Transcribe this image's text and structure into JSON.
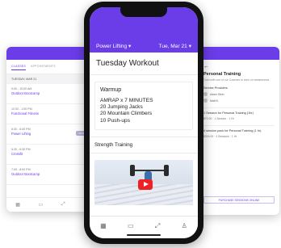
{
  "colors": {
    "accent": "#6a3de8"
  },
  "left_panel": {
    "tabs": [
      "CLASSES",
      "APPOINTMENTS"
    ],
    "day": "TUESDAY, MAR 21",
    "classes": [
      {
        "time": "5:00 - 10:00 AM",
        "name": "Outdoor Bootcamp"
      },
      {
        "time": "12:00 - 1:00 PM",
        "name": "Functional Fitness"
      },
      {
        "time": "5:30 - 6:30 PM",
        "name": "Power Lifting",
        "tag": "WAITLIST"
      },
      {
        "time": "5:30 - 6:30 PM",
        "name": "Crossfit"
      },
      {
        "time": "7:00 - 8:00 PM",
        "name": "Outdoor Bootcamp"
      }
    ],
    "nav_icons": [
      "calendar-icon",
      "card-icon",
      "dumbbell-icon",
      "profile-icon"
    ]
  },
  "phone": {
    "program": "Power Lifting",
    "date": "Tue, Mar 21",
    "workout_title": "Tuesday Workout",
    "warmup": {
      "heading": "Warmup",
      "lines": [
        "AMRAP x 7 MINUTES",
        "20 Jumping Jacks",
        "20 Mountain Climbers",
        "10 Push-ups"
      ]
    },
    "strength_heading": "Strength Training",
    "nav_icons": [
      "calendar-icon",
      "card-icon",
      "dumbbell-icon",
      "profile-icon"
    ]
  },
  "right_panel": {
    "back": "←",
    "title": "Personal Training",
    "description": "Train with one of our Coaches to work on weaknesses",
    "providers_label": "Service Providers",
    "providers": [
      "Adam Stein",
      "Matt B."
    ],
    "packages": [
      {
        "name": "1 Session for Personal Training (1hr)",
        "price": "$70.00 · 1 Session · 1 Hr"
      },
      {
        "name": "4 session pack for Personal Training (1 hr)",
        "price": "$216.00 · 4 Sessions · 1 Hr"
      }
    ],
    "purchase_label": "PURCHASE SESSIONS ONLINE"
  }
}
